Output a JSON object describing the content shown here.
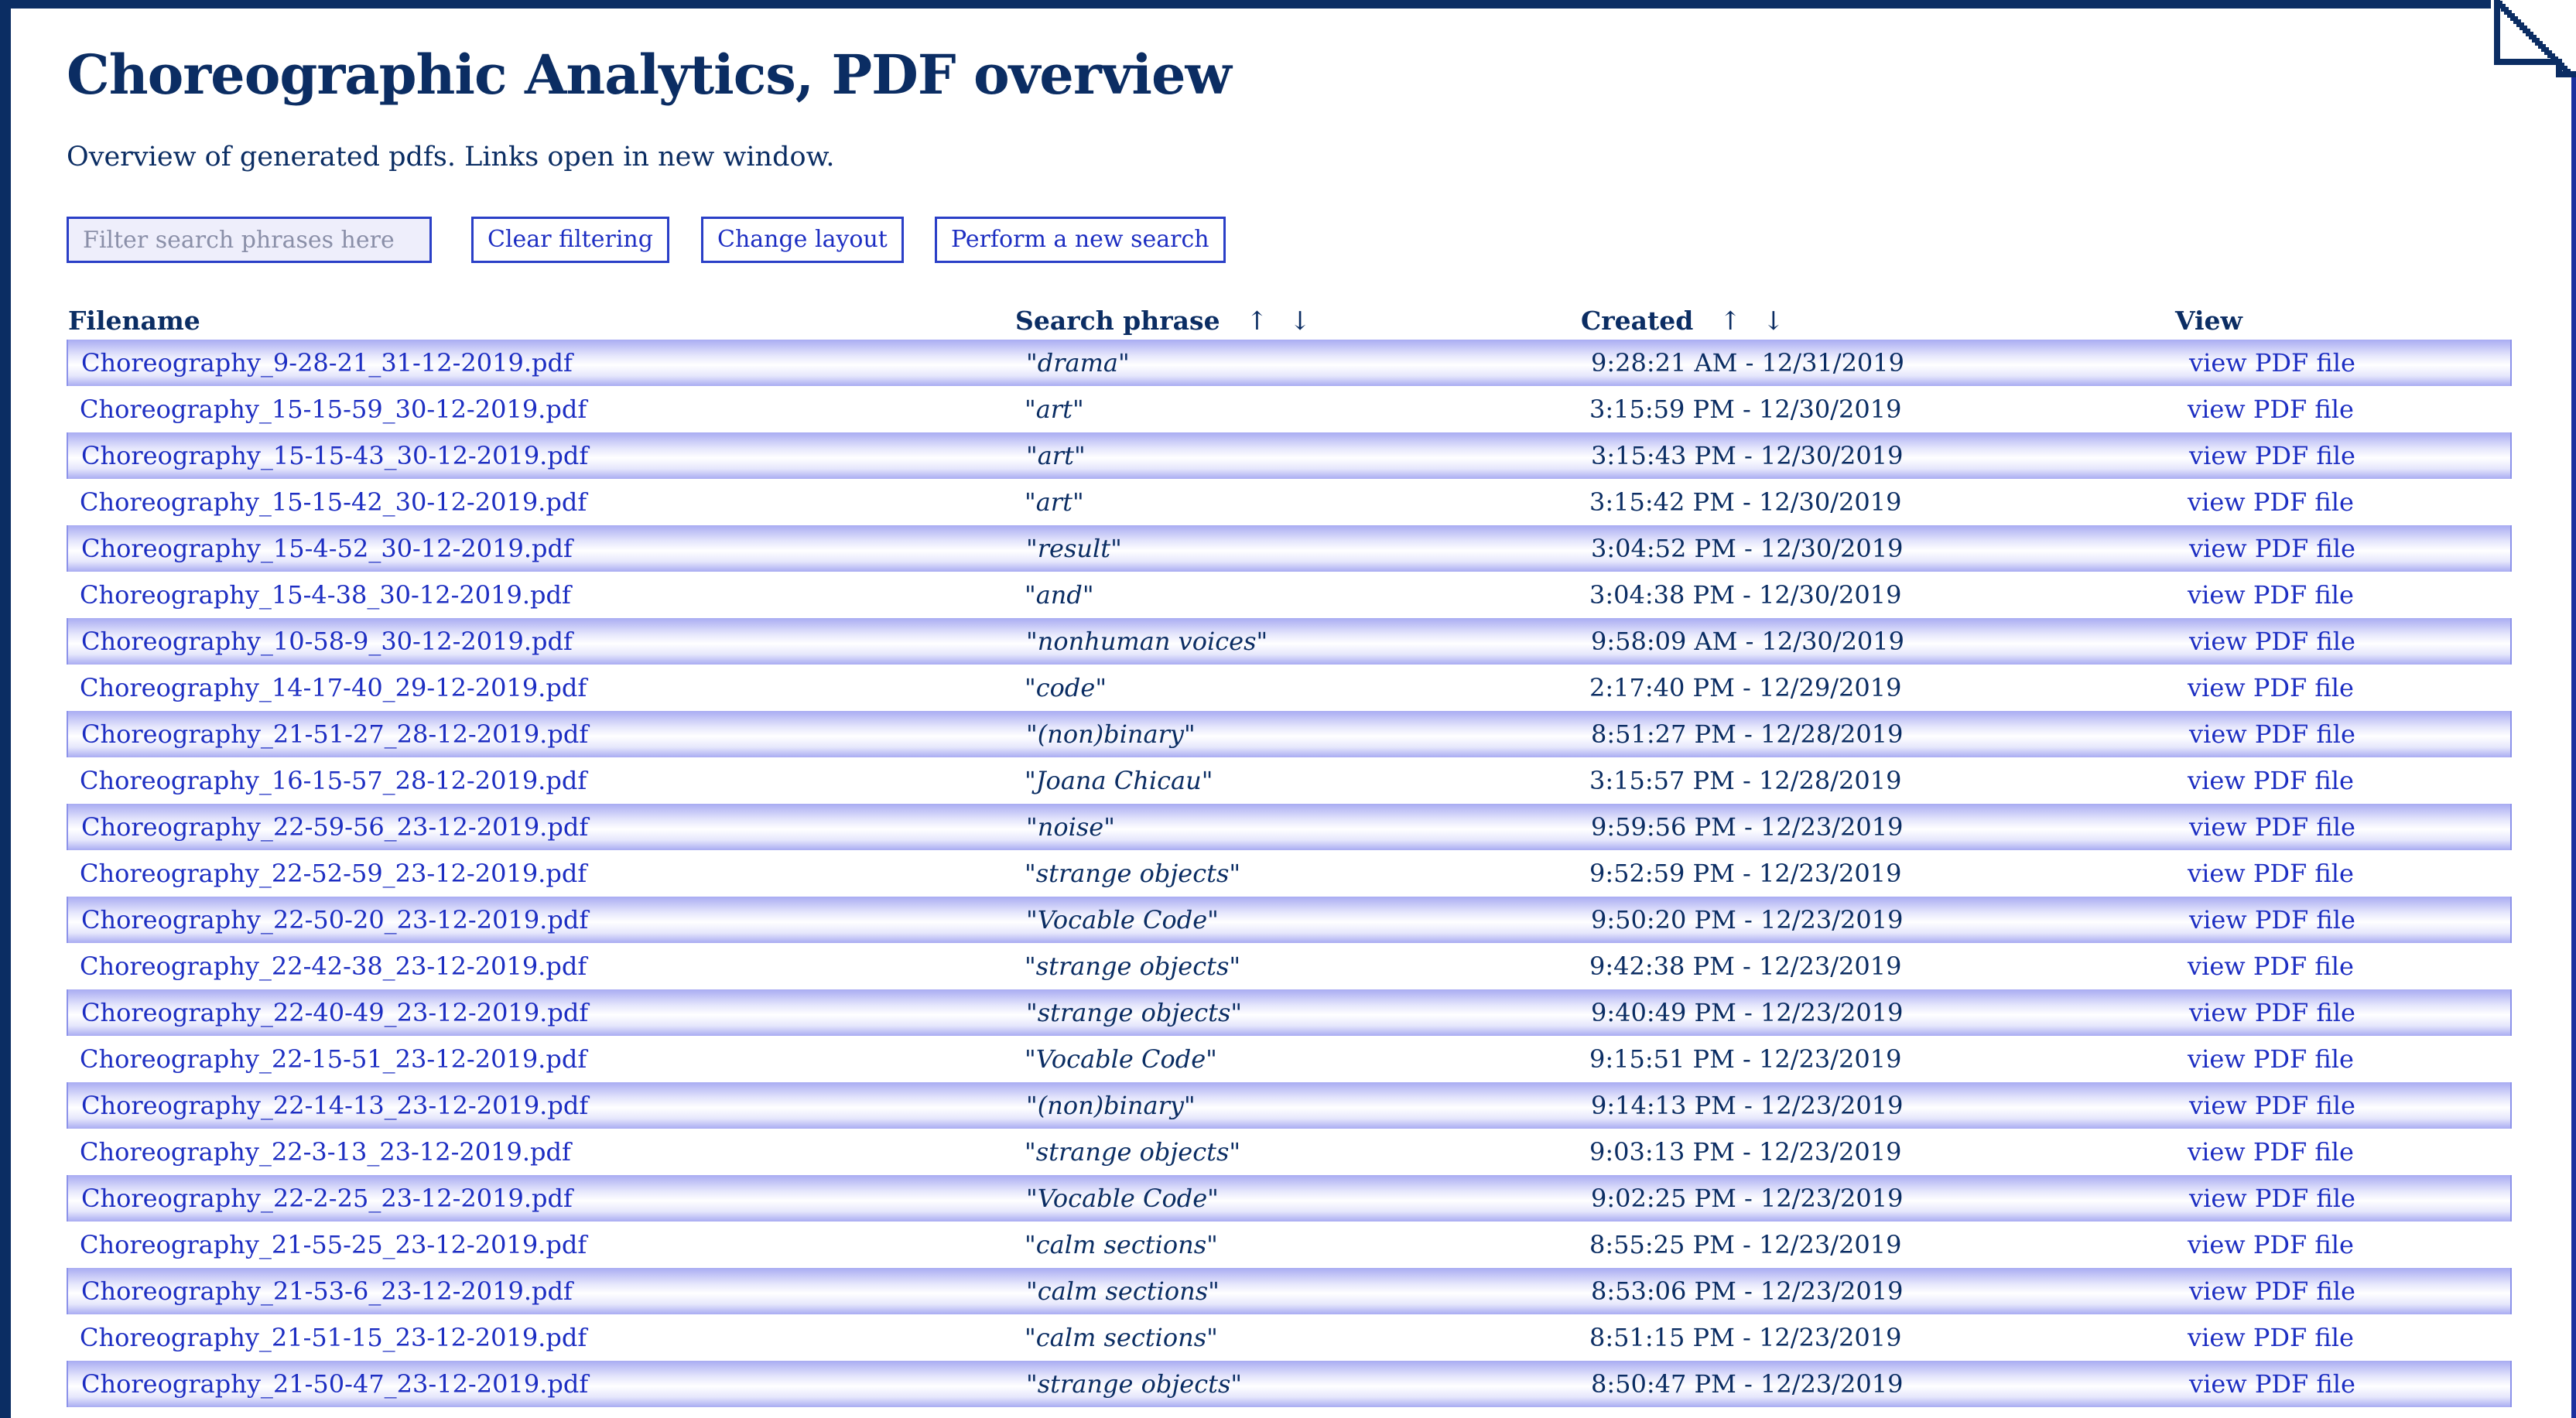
{
  "page": {
    "title": "Choreographic Analytics, PDF overview",
    "subtitle": "Overview of generated pdfs. Links open in new window."
  },
  "controls": {
    "filter_placeholder": "Filter search phrases here",
    "clear_label": "Clear filtering",
    "layout_label": "Change layout",
    "search_label": "Perform a new search"
  },
  "table": {
    "headers": {
      "filename": "Filename",
      "phrase": "Search phrase",
      "created": "Created",
      "view": "View",
      "sort_up": "↑",
      "sort_down": "↓"
    },
    "rows": [
      {
        "file": "Choreography_9-28-21_31-12-2019.pdf",
        "phrase": "\"drama\"",
        "created": "9:28:21 AM - 12/31/2019",
        "view": "view PDF file"
      },
      {
        "file": "Choreography_15-15-59_30-12-2019.pdf",
        "phrase": "\"art\"",
        "created": "3:15:59 PM - 12/30/2019",
        "view": "view PDF file"
      },
      {
        "file": "Choreography_15-15-43_30-12-2019.pdf",
        "phrase": "\"art\"",
        "created": "3:15:43 PM - 12/30/2019",
        "view": "view PDF file"
      },
      {
        "file": "Choreography_15-15-42_30-12-2019.pdf",
        "phrase": "\"art\"",
        "created": "3:15:42 PM - 12/30/2019",
        "view": "view PDF file"
      },
      {
        "file": "Choreography_15-4-52_30-12-2019.pdf",
        "phrase": "\"result\"",
        "created": "3:04:52 PM - 12/30/2019",
        "view": "view PDF file"
      },
      {
        "file": "Choreography_15-4-38_30-12-2019.pdf",
        "phrase": "\"and\"",
        "created": "3:04:38 PM - 12/30/2019",
        "view": "view PDF file"
      },
      {
        "file": "Choreography_10-58-9_30-12-2019.pdf",
        "phrase": "\"nonhuman voices\"",
        "created": "9:58:09 AM - 12/30/2019",
        "view": "view PDF file"
      },
      {
        "file": "Choreography_14-17-40_29-12-2019.pdf",
        "phrase": "\"code\"",
        "created": "2:17:40 PM - 12/29/2019",
        "view": "view PDF file"
      },
      {
        "file": "Choreography_21-51-27_28-12-2019.pdf",
        "phrase": "\"(non)binary\"",
        "created": "8:51:27 PM - 12/28/2019",
        "view": "view PDF file"
      },
      {
        "file": "Choreography_16-15-57_28-12-2019.pdf",
        "phrase": "\"Joana Chicau\"",
        "created": "3:15:57 PM - 12/28/2019",
        "view": "view PDF file"
      },
      {
        "file": "Choreography_22-59-56_23-12-2019.pdf",
        "phrase": "\"noise\"",
        "created": "9:59:56 PM - 12/23/2019",
        "view": "view PDF file"
      },
      {
        "file": "Choreography_22-52-59_23-12-2019.pdf",
        "phrase": "\"strange objects\"",
        "created": "9:52:59 PM - 12/23/2019",
        "view": "view PDF file"
      },
      {
        "file": "Choreography_22-50-20_23-12-2019.pdf",
        "phrase": "\"Vocable Code\"",
        "created": "9:50:20 PM - 12/23/2019",
        "view": "view PDF file"
      },
      {
        "file": "Choreography_22-42-38_23-12-2019.pdf",
        "phrase": "\"strange objects\"",
        "created": "9:42:38 PM - 12/23/2019",
        "view": "view PDF file"
      },
      {
        "file": "Choreography_22-40-49_23-12-2019.pdf",
        "phrase": "\"strange objects\"",
        "created": "9:40:49 PM - 12/23/2019",
        "view": "view PDF file"
      },
      {
        "file": "Choreography_22-15-51_23-12-2019.pdf",
        "phrase": "\"Vocable Code\"",
        "created": "9:15:51 PM - 12/23/2019",
        "view": "view PDF file"
      },
      {
        "file": "Choreography_22-14-13_23-12-2019.pdf",
        "phrase": "\"(non)binary\"",
        "created": "9:14:13 PM - 12/23/2019",
        "view": "view PDF file"
      },
      {
        "file": "Choreography_22-3-13_23-12-2019.pdf",
        "phrase": "\"strange objects\"",
        "created": "9:03:13 PM - 12/23/2019",
        "view": "view PDF file"
      },
      {
        "file": "Choreography_22-2-25_23-12-2019.pdf",
        "phrase": "\"Vocable Code\"",
        "created": "9:02:25 PM - 12/23/2019",
        "view": "view PDF file"
      },
      {
        "file": "Choreography_21-55-25_23-12-2019.pdf",
        "phrase": "\"calm sections\"",
        "created": "8:55:25 PM - 12/23/2019",
        "view": "view PDF file"
      },
      {
        "file": "Choreography_21-53-6_23-12-2019.pdf",
        "phrase": "\"calm sections\"",
        "created": "8:53:06 PM - 12/23/2019",
        "view": "view PDF file"
      },
      {
        "file": "Choreography_21-51-15_23-12-2019.pdf",
        "phrase": "\"calm sections\"",
        "created": "8:51:15 PM - 12/23/2019",
        "view": "view PDF file"
      },
      {
        "file": "Choreography_21-50-47_23-12-2019.pdf",
        "phrase": "\"strange objects\"",
        "created": "8:50:47 PM - 12/23/2019",
        "view": "view PDF file"
      }
    ]
  },
  "colors": {
    "frame": "#0b2d63",
    "link": "#1d2ec2",
    "text": "#0b2d63",
    "stripe": "#a9acf2"
  }
}
